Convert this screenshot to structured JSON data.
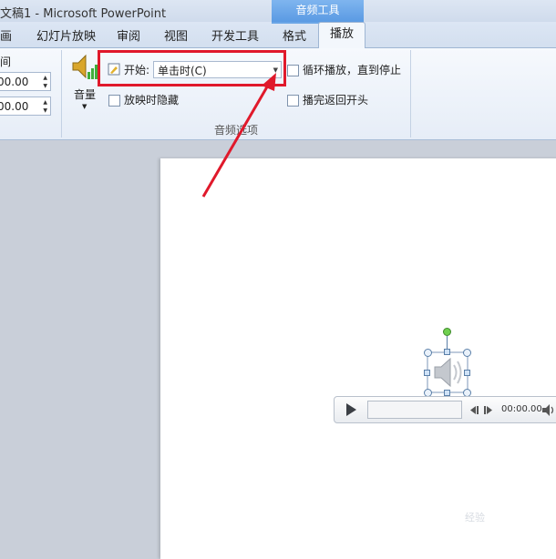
{
  "window": {
    "title": "文稿1  -  Microsoft PowerPoint",
    "context_tab_group": "音频工具"
  },
  "tabs": [
    {
      "label": "画"
    },
    {
      "label": "幻灯片放映"
    },
    {
      "label": "审阅"
    },
    {
      "label": "视图"
    },
    {
      "label": "开发工具"
    },
    {
      "label": "格式"
    },
    {
      "label": "播放"
    }
  ],
  "ribbon": {
    "timing_label": "间",
    "fade_in_value": "00.00",
    "fade_out_value": "00.00",
    "volume_label": "音量",
    "start_label": "开始:",
    "start_value": "单击时(C)",
    "hide_during_show_label": "放映时隐藏",
    "loop_label": "循环播放，直到停止",
    "rewind_label": "播完返回开头",
    "group_label": "音频选项",
    "checkboxes": {
      "hide_during_show": false,
      "loop": false,
      "rewind": false
    }
  },
  "player": {
    "time": "00:00.00",
    "progress": 0
  },
  "colors": {
    "highlight": "#e0192b",
    "arrow": "#e0192b",
    "accent": "#5a9ae3"
  },
  "watermark": "经验"
}
